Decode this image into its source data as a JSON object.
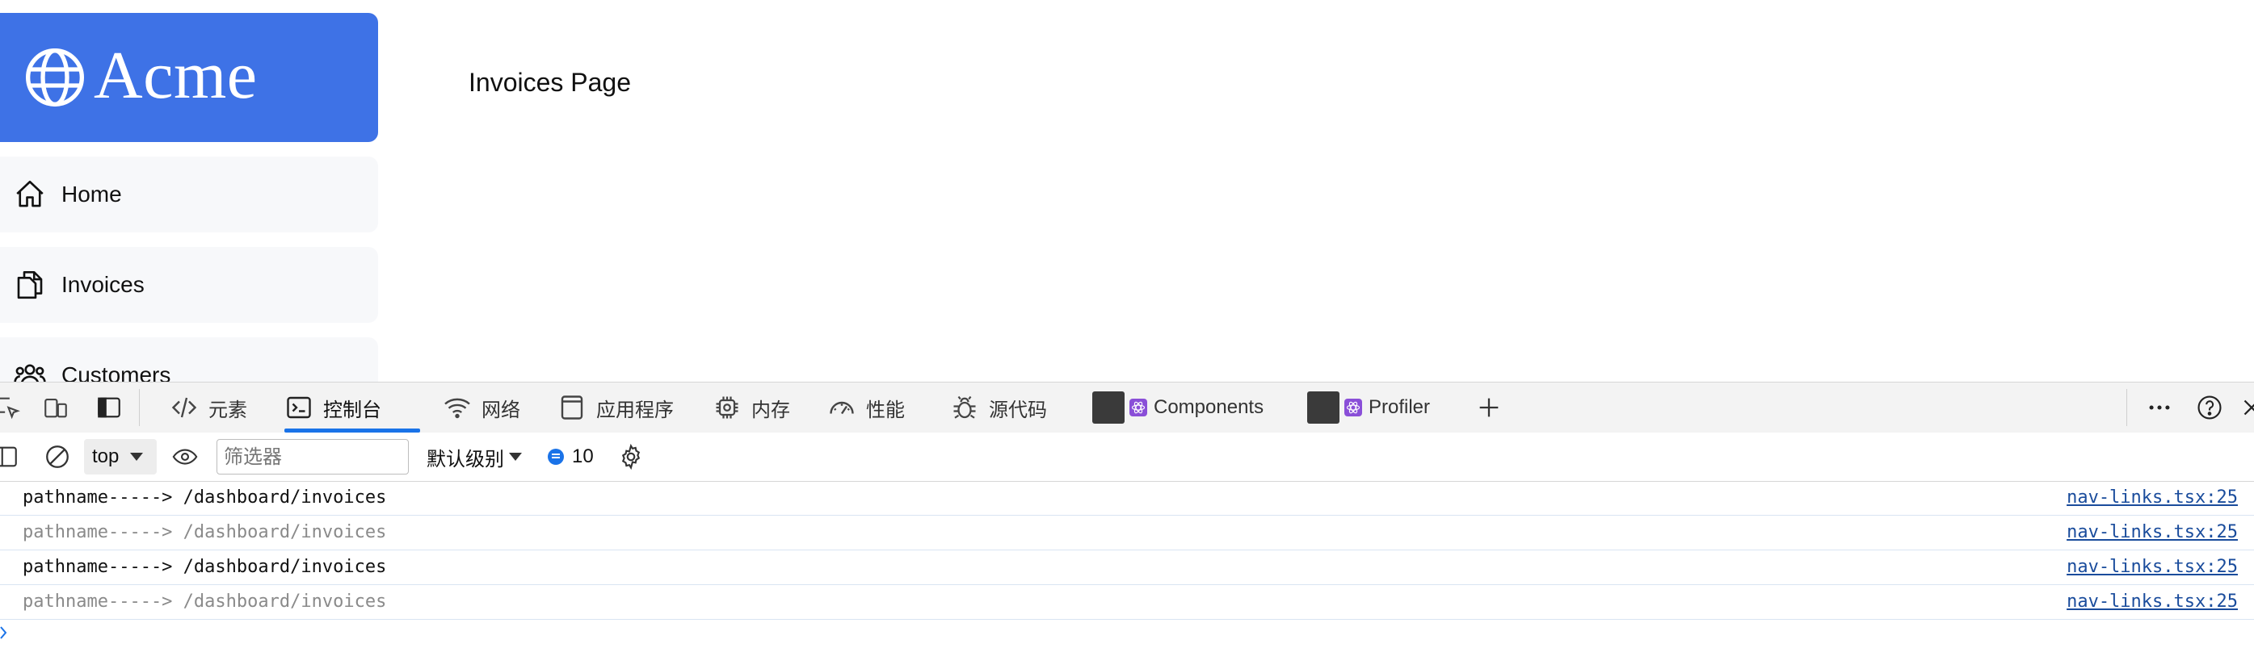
{
  "app": {
    "logo_text": "Acme",
    "page_title": "Invoices Page",
    "nav": [
      {
        "label": "Home",
        "icon": "home-icon"
      },
      {
        "label": "Invoices",
        "icon": "document-duplicate-icon"
      },
      {
        "label": "Customers",
        "icon": "user-group-icon"
      }
    ],
    "colors": {
      "brand": "#3e72e6",
      "nav_bg": "#f7f8fa"
    }
  },
  "devtools": {
    "tabs": [
      {
        "label": "元素",
        "icon": "code-icon"
      },
      {
        "label": "控制台",
        "icon": "console-icon",
        "active": true
      },
      {
        "label": "网络",
        "icon": "wifi-icon"
      },
      {
        "label": "应用程序",
        "icon": "application-icon"
      },
      {
        "label": "内存",
        "icon": "memory-chip-icon"
      },
      {
        "label": "性能",
        "icon": "performance-gauge-icon"
      },
      {
        "label": "源代码",
        "icon": "bug-icon"
      },
      {
        "label": "Components",
        "icon": "react-icon"
      },
      {
        "label": "Profiler",
        "icon": "react-icon"
      }
    ],
    "toolbar": {
      "context": "top",
      "filter_placeholder": "筛选器",
      "level": "默认级别",
      "message_count": "10"
    },
    "logs": [
      {
        "message": "pathname-----> /dashboard/invoices",
        "source": "nav-links.tsx:25",
        "dim": false
      },
      {
        "message": "pathname-----> /dashboard/invoices",
        "source": "nav-links.tsx:25",
        "dim": true
      },
      {
        "message": "pathname-----> /dashboard/invoices",
        "source": "nav-links.tsx:25",
        "dim": false
      },
      {
        "message": "pathname-----> /dashboard/invoices",
        "source": "nav-links.tsx:25",
        "dim": true
      }
    ],
    "colors": {
      "accent": "#1a73e8",
      "link": "#1a4c9c"
    }
  }
}
